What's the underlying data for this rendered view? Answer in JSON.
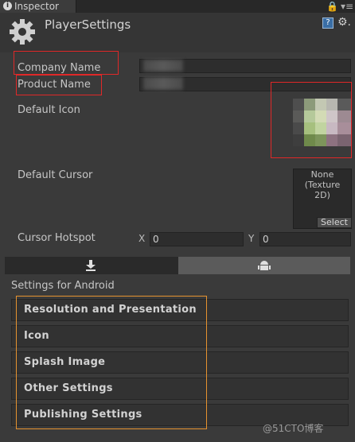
{
  "tab": {
    "title": "Inspector",
    "icon": "info-icon",
    "lock_icon": "lock-icon",
    "menu_icon": "tab-menu-icon"
  },
  "header": {
    "title": "PlayerSettings",
    "icon": "gear-icon",
    "help_icon": "book-help-icon",
    "settings_icon": "settings-gear-icon"
  },
  "fields": {
    "company_name_label": "Company Name",
    "product_name_label": "Product Name",
    "default_icon_label": "Default Icon",
    "default_cursor_label": "Default Cursor",
    "cursor_hotspot_label": "Cursor Hotspot",
    "hotspot_x_label": "X",
    "hotspot_x_value": "0",
    "hotspot_y_label": "Y",
    "hotspot_y_value": "0"
  },
  "texture_slot": {
    "line1": "None",
    "line2": "(Texture",
    "line3": "2D)",
    "select_label": "Select"
  },
  "platform_tabs": [
    {
      "name": "download-icon",
      "active": false
    },
    {
      "name": "android-icon",
      "active": true
    }
  ],
  "settings_for": "Settings for Android",
  "sections": [
    "Resolution and Presentation",
    "Icon",
    "Splash Image",
    "Other Settings",
    "Publishing Settings"
  ],
  "watermark": "@51CTO博客",
  "colors": {
    "highlight_red": "#e02828",
    "highlight_orange": "#e6932f"
  }
}
